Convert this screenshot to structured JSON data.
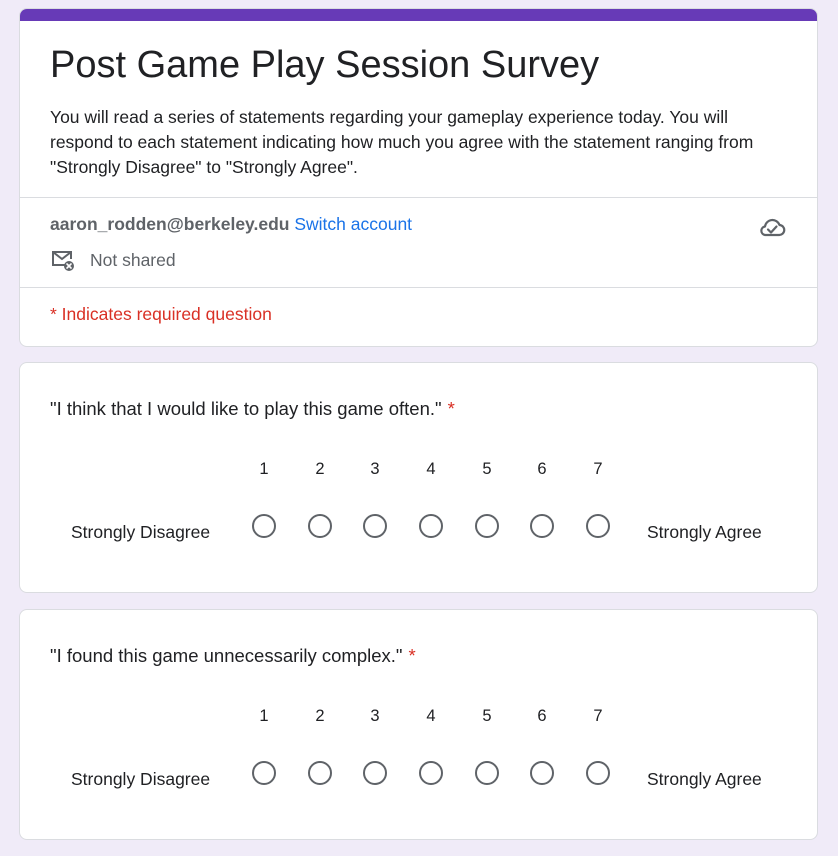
{
  "form": {
    "title": "Post Game Play Session Survey",
    "description": "You will read a series of statements regarding your gameplay experience today. You will respond to each statement indicating how much you agree with the statement ranging from \"Strongly Disagree\" to \"Strongly Agree\".",
    "accent_color": "#673ab7",
    "background_color": "#f0ebf8"
  },
  "account": {
    "email": "aaron_rodden@berkeley.edu",
    "switch_label": "Switch account",
    "sharing_status": "Not shared",
    "sharing_icon": "mail-off-icon",
    "save_status_icon": "cloud-done-icon"
  },
  "required_note": "* Indicates required question",
  "questions": [
    {
      "title": "\"I think that I would like to play this game often.\"",
      "required_marker": "*",
      "scale": [
        "1",
        "2",
        "3",
        "4",
        "5",
        "6",
        "7"
      ],
      "low_label": "Strongly Disagree",
      "high_label": "Strongly Agree",
      "selected": null
    },
    {
      "title": "\"I found this game unnecessarily complex.\"",
      "required_marker": "*",
      "scale": [
        "1",
        "2",
        "3",
        "4",
        "5",
        "6",
        "7"
      ],
      "low_label": "Strongly Disagree",
      "high_label": "Strongly Agree",
      "selected": null
    }
  ]
}
